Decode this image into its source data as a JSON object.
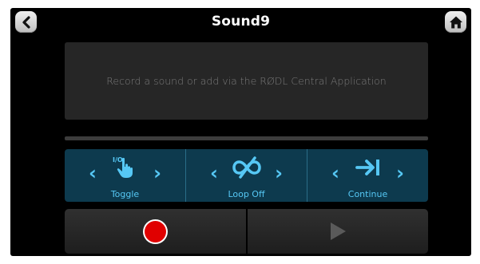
{
  "header": {
    "title": "Sound9",
    "back_icon": "chevron-left-icon",
    "home_icon": "home-icon"
  },
  "sound_panel": {
    "message": "Record a sound or add via the RØDL Central Application"
  },
  "progress": {
    "fraction": 0.0
  },
  "controls": [
    {
      "label": "Toggle",
      "icon": "touch-toggle-icon",
      "tag": "I/O"
    },
    {
      "label": "Loop Off",
      "icon": "loop-off-icon"
    },
    {
      "label": "Continue",
      "icon": "continue-icon"
    }
  ],
  "transport": {
    "record_icon": "record-icon",
    "play_icon": "play-icon"
  },
  "colors": {
    "accent": "#56c8f5",
    "control_bg": "#0d3a4e",
    "record": "#e00000",
    "panel": "#262626"
  }
}
